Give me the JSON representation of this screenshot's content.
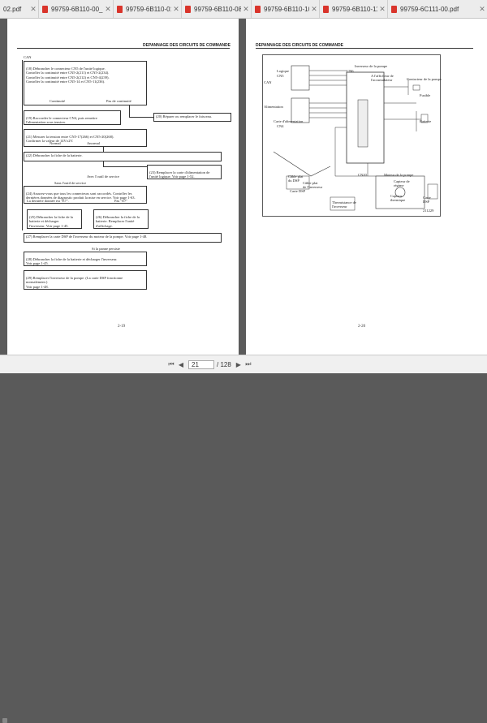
{
  "tabs": [
    {
      "label": "02.pdf"
    },
    {
      "label": "99759-6B110-00_FOR..."
    },
    {
      "label": "99759-6B110-01_GE..."
    },
    {
      "label": "99759-6B110-08_HY..."
    },
    {
      "label": "99759-6B110-10_SER..."
    },
    {
      "label": "99759-6B110-11_OP..."
    },
    {
      "label": "99759-6C111-00.pdf"
    }
  ],
  "page_left": {
    "header": "DEPANNAGE DES CIRCUITS DE COMMANDE",
    "page_number": "2-19",
    "can": "CAN",
    "step18": "(18) Débrancher le connecteur CN5 de l'unité logique.\n     Contrôler la continuité entre CN5-2(211) et CN5-2(234).\n     Contrôler la continuité entre CN5-2(212) et CN5-4(239).\n     Contrôler la continuité entre CN5-14 et CN5-11(236).",
    "step18_ok": "Continuité",
    "step18_ng": "Pas de continuité",
    "step19": "(19) Raccorder le connecteur CN4, puis remettre\n     l'alimentation sous tension.",
    "step20": "(20) Réparer ou remplacer le faisceau.",
    "step21": "(21) Mesurer la tension entre CN5-17(266) et CN5-20(268).\n     Confirmer la valeur de 14V±2V.",
    "step21_normal": "Normal",
    "step21_abnormal": "Anormal",
    "step22": "(22) Débrancher la fiche de la batterie.",
    "step23": "(23) Remplacer la carte d'alimentation de\n     l'unité logique. Voir page 1-52.",
    "with_tool": "Avec l'outil de service",
    "without_tool": "Sans l'outil de service",
    "step24": "(24) Assurez-vous que tous les connecteurs sont raccordés. Contrôler les\n     dernières données de diagnostic produit la mise en service. Voir page 1-63.",
    "step24_last": "La dernière donnée est \"E7\".",
    "step24_not": "Pas \"E7\"",
    "step25": "(25) Débrancher la fiche de la\n     batterie et décharger\n     l'inverseur. Voir page 1-45.",
    "step26": "(26) Débrancher la fiche de la\n     batterie. Remplacer l'unité\n     d'affichage.",
    "step27": "(27) Remplacer la carte DSP de l'inverseur du moteur de la pompe. Voir page 1-48.",
    "if_persists": "Si la panne persiste",
    "step28": "(28) Débrancher la fiche de la batterie et décharger l'inverseur.\n     Voir page 1-45.",
    "step29": "(29) Remplacer l'inverseur de la pompe. (La carte DSP fonctionne\n     normalement.)\n     Voir page 1-48."
  },
  "page_right": {
    "header": "DEPANNAGE DES CIRCUITS DE COMMANDE",
    "page_number": "2-20",
    "labels": {
      "logic": "Logique",
      "cn5": "CN5",
      "can": "CAN",
      "alimentation": "Alimentation",
      "cn4": "CN4",
      "carte_alim": "Carte d'alimentation",
      "cn6": "CN6",
      "inverseur": "Inverseur de la pompe",
      "afficheur": "A l'afficheur de\nl'accumulateur",
      "contacteur": "Contacteur de la pompe",
      "fusible": "Fusible",
      "batterie": "Batterie",
      "cable_dsp": "Câble plat\ndu DSP",
      "carte_dsp": "Carte DSP",
      "thermistance": "Thermistance de\nl'inverseur",
      "cable_plat": "Câble plat\nde l'inverseur",
      "moteur": "Moteur de la pompe",
      "capteur_regime": "Capteur de\nrégime",
      "capteur_therm": "Capteur\nthermique",
      "carte_dsp2": "Carte\nDSP",
      "cn20": "CN20",
      "fig": "211229"
    }
  },
  "toolbar": {
    "page_current": "21",
    "page_total": "/ 128"
  }
}
